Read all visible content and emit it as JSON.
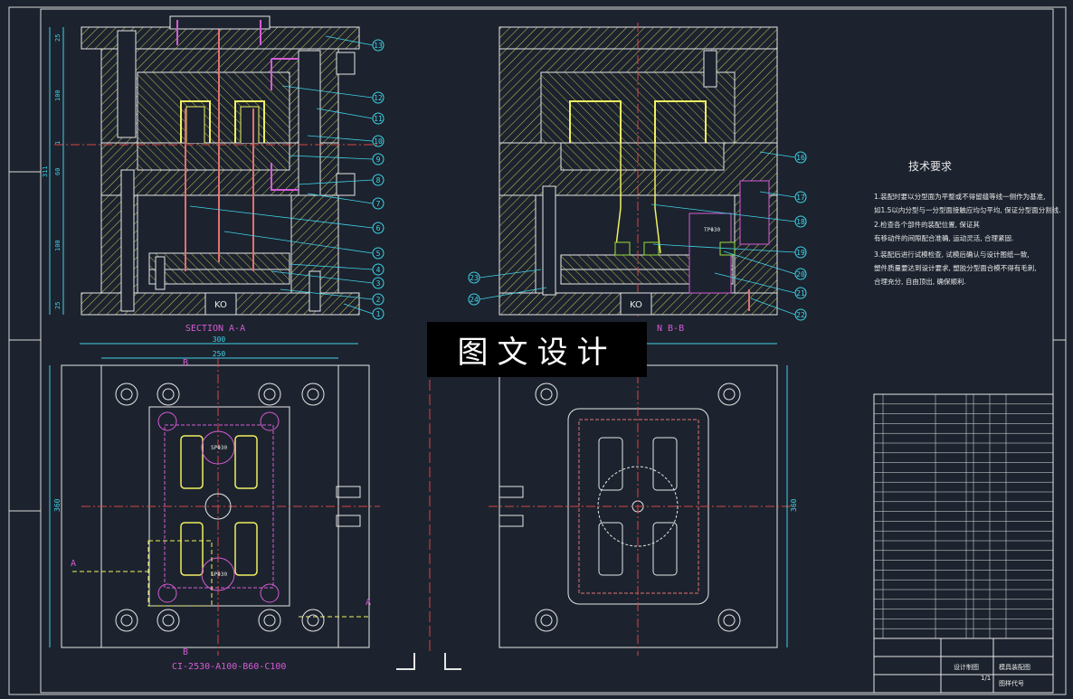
{
  "drawing": {
    "section_aa_title": "SECTION A-A",
    "section_bb_title": "N B-B",
    "mold_code": "CI-2530-A100-B60-C100",
    "base_label": "KO",
    "tp_label": "TPΦ30",
    "sp_label": "SPΦ30",
    "dims_left": [
      "25",
      "100",
      "1",
      "60",
      "100",
      "25"
    ],
    "dim_total_height": "311",
    "dim_width_outer": "300",
    "dim_width_inner": "250",
    "dim_plan_height": "360",
    "section_marker_a": "A",
    "section_marker_b": "B",
    "balloons_left": [
      "13",
      "12",
      "11",
      "10",
      "9",
      "8",
      "7",
      "6",
      "5",
      "4",
      "3",
      "2",
      "1"
    ],
    "balloons_right": [
      "16",
      "17",
      "18",
      "19",
      "20",
      "21",
      "22",
      "23",
      "24"
    ]
  },
  "tech_requirements": {
    "title": "技术要求",
    "lines": [
      "1.装配时要以分型面为平整或不得留缝等线一侧作为基准,",
      "如1.5以内分型与一分型面接触应均匀平均, 保证分型面分割线.",
      "2.检查各个部件的装配位置, 保证其",
      "有移动件的间隙配合准确, 运动灵活, 合理紧固.",
      "3.装配后进行试模检查, 试模后确认与设计图纸一致,",
      "塑件质量要达到设计要求, 塑胶分型面合模不得有毛刺,",
      "合理充分, 自由顶出, 确保顺利."
    ]
  },
  "title_block": {
    "designer": "设计制图",
    "drawing_name": "模具装配图",
    "drawing_no": "图样代号",
    "sheet": "1/1"
  },
  "watermark": "图文设计"
}
